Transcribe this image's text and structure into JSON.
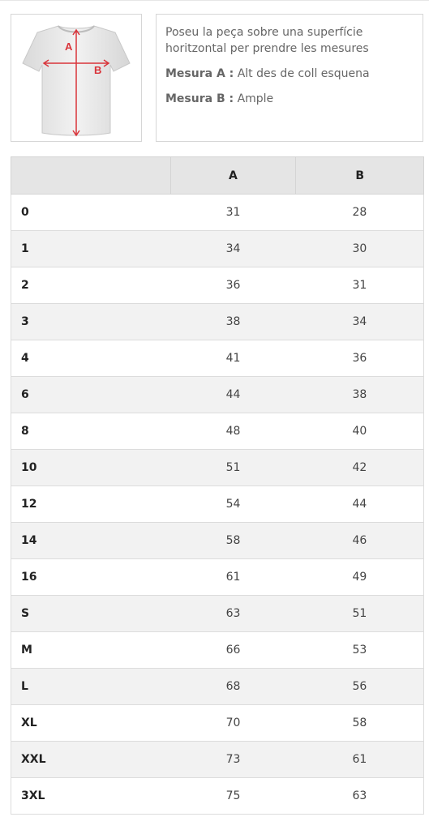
{
  "intro": {
    "instruction": "Poseu la peça sobre una superfície horitzontal per prendre les mesures",
    "measure_a_label": "Mesura A :",
    "measure_a_text": "Alt des de coll esquena",
    "measure_b_label": "Mesura B :",
    "measure_b_text": "Ample",
    "diagram_label_a": "A",
    "diagram_label_b": "B"
  },
  "table": {
    "headers": [
      "",
      "A",
      "B"
    ],
    "rows": [
      [
        "0",
        "31",
        "28"
      ],
      [
        "1",
        "34",
        "30"
      ],
      [
        "2",
        "36",
        "31"
      ],
      [
        "3",
        "38",
        "34"
      ],
      [
        "4",
        "41",
        "36"
      ],
      [
        "6",
        "44",
        "38"
      ],
      [
        "8",
        "48",
        "40"
      ],
      [
        "10",
        "51",
        "42"
      ],
      [
        "12",
        "54",
        "44"
      ],
      [
        "14",
        "58",
        "46"
      ],
      [
        "16",
        "61",
        "49"
      ],
      [
        "S",
        "63",
        "51"
      ],
      [
        "M",
        "66",
        "53"
      ],
      [
        "L",
        "68",
        "56"
      ],
      [
        "XL",
        "70",
        "58"
      ],
      [
        "XXL",
        "73",
        "61"
      ],
      [
        "3XL",
        "75",
        "63"
      ]
    ]
  },
  "colors": {
    "measure_arrow": "#d9343a",
    "shirt": "#e8e8e8"
  }
}
